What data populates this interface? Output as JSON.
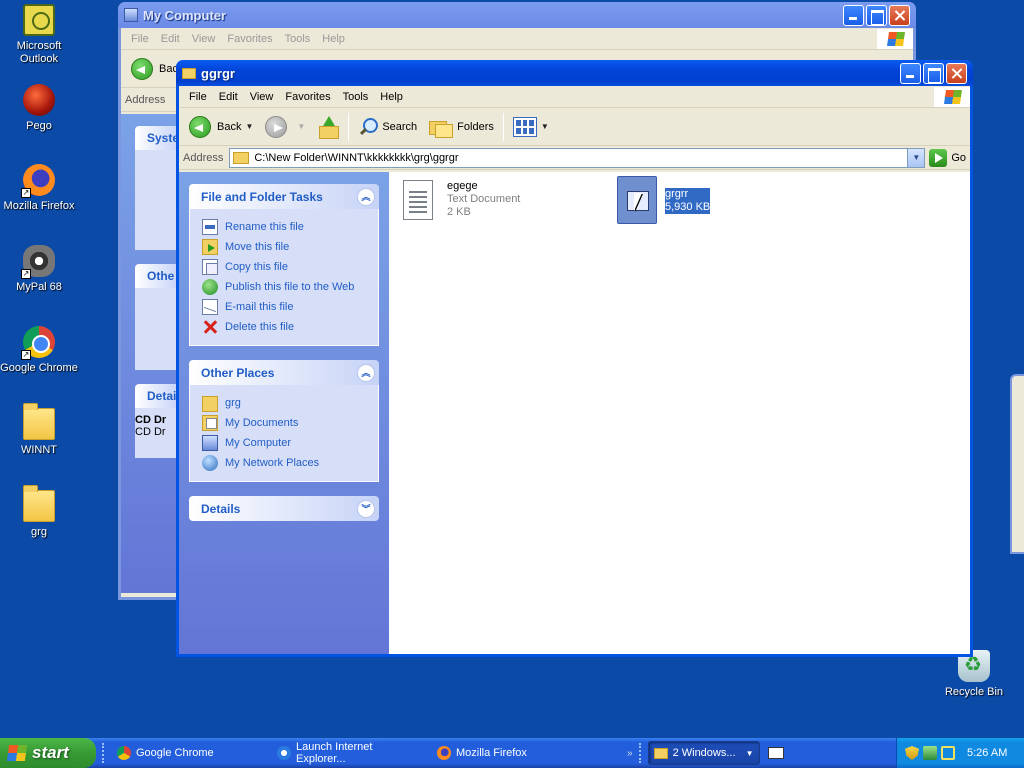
{
  "desktop": {
    "icons": [
      {
        "label": "Microsoft Outlook",
        "icon": "outlook-icon"
      },
      {
        "label": "Pego",
        "icon": "pego-icon"
      },
      {
        "label": "Mozilla Firefox",
        "icon": "firefox-icon"
      },
      {
        "label": "MyPal 68",
        "icon": "mypal-icon"
      },
      {
        "label": "Google Chrome",
        "icon": "chrome-icon"
      },
      {
        "label": "WINNT",
        "icon": "folder-icon"
      },
      {
        "label": "grg",
        "icon": "folder-icon"
      },
      {
        "label": "Recycle Bin",
        "icon": "recycle-bin-icon"
      }
    ]
  },
  "back_window": {
    "title": "My Computer",
    "menu": [
      "File",
      "Edit",
      "View",
      "Favorites",
      "Tools",
      "Help"
    ],
    "back_label_partial": "Bac",
    "address_label": "Address",
    "panes": [
      {
        "title": "Syste"
      },
      {
        "title": "Othe"
      },
      {
        "title": "Detai"
      }
    ],
    "details_lines": [
      "CD Dr",
      "CD Dr"
    ]
  },
  "front_window": {
    "title": "ggrgr",
    "menu": [
      "File",
      "Edit",
      "View",
      "Favorites",
      "Tools",
      "Help"
    ],
    "toolbar": {
      "back": "Back",
      "search": "Search",
      "folders": "Folders"
    },
    "address": {
      "label": "Address",
      "path": "C:\\New Folder\\WINNT\\kkkkkkkk\\grg\\ggrgr",
      "go": "Go"
    },
    "task_panes": {
      "file_tasks": {
        "title": "File and Folder Tasks",
        "items": [
          {
            "label": "Rename this file",
            "icon": "rename-icon"
          },
          {
            "label": "Move this file",
            "icon": "move-icon"
          },
          {
            "label": "Copy this file",
            "icon": "copy-icon"
          },
          {
            "label": "Publish this file to the Web",
            "icon": "publish-web-icon"
          },
          {
            "label": "E-mail this file",
            "icon": "email-icon"
          },
          {
            "label": "Delete this file",
            "icon": "delete-icon"
          }
        ]
      },
      "other_places": {
        "title": "Other Places",
        "items": [
          {
            "label": "grg",
            "icon": "folder-icon"
          },
          {
            "label": "My Documents",
            "icon": "my-documents-icon"
          },
          {
            "label": "My Computer",
            "icon": "my-computer-icon"
          },
          {
            "label": "My Network Places",
            "icon": "network-places-icon"
          }
        ]
      },
      "details": {
        "title": "Details"
      }
    },
    "files": [
      {
        "name": "egege",
        "type": "Text Document",
        "size": "2 KB",
        "selected": false
      },
      {
        "name": "grgrr",
        "size": "5,930 KB",
        "selected": true
      }
    ]
  },
  "taskbar": {
    "start": "start",
    "tasks": [
      {
        "label": "Google Chrome",
        "icon": "chrome-icon"
      },
      {
        "label": "Launch Internet Explorer...",
        "icon": "internet-explorer-icon"
      },
      {
        "label": "Mozilla Firefox",
        "icon": "firefox-icon"
      }
    ],
    "group": "2 Windows...",
    "clock": "5:26 AM"
  },
  "colors": {
    "desktop": "#0b4aa7",
    "title_active": "#0343d8",
    "taskpane": "#6375d6",
    "link": "#215dc6",
    "selection": "#316ac5"
  }
}
